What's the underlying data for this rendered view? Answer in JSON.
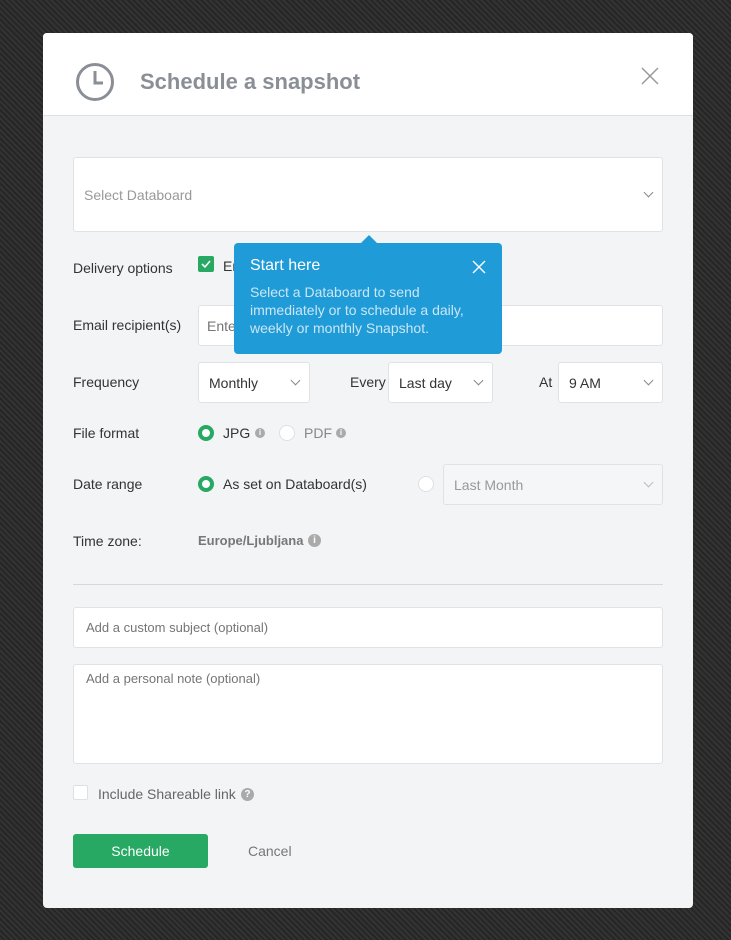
{
  "header": {
    "title": "Schedule a snapshot",
    "icon": "clock-icon"
  },
  "databoard_select": {
    "placeholder": "Select Databoard"
  },
  "delivery": {
    "label": "Delivery options",
    "email_option": "Email",
    "email_checked": true
  },
  "recipients": {
    "label": "Email recipient(s)",
    "placeholder": "Enter email"
  },
  "frequency": {
    "label": "Frequency",
    "value": "Monthly",
    "every_label": "Every",
    "every_value": "Last day",
    "at_label": "At",
    "at_value": "9 AM"
  },
  "file_format": {
    "label": "File format",
    "options": [
      "JPG",
      "PDF"
    ],
    "selected": "JPG"
  },
  "date_range": {
    "label": "Date range",
    "option1": "As set on Databoard(s)",
    "option2_value": "Last Month",
    "selected": "As set on Databoard(s)"
  },
  "timezone": {
    "label": "Time zone:",
    "value": "Europe/Ljubljana"
  },
  "subject": {
    "placeholder": "Add a custom subject (optional)"
  },
  "note": {
    "placeholder": "Add a personal note (optional)"
  },
  "shareable": {
    "label": "Include Shareable link",
    "checked": false
  },
  "actions": {
    "schedule": "Schedule",
    "cancel": "Cancel"
  },
  "tooltip": {
    "title": "Start here",
    "body": "Select a Databoard to send immediately or to schedule a daily, weekly or monthly Snapshot."
  },
  "colors": {
    "accent": "#27a863",
    "tooltip": "#1f9bd7"
  }
}
